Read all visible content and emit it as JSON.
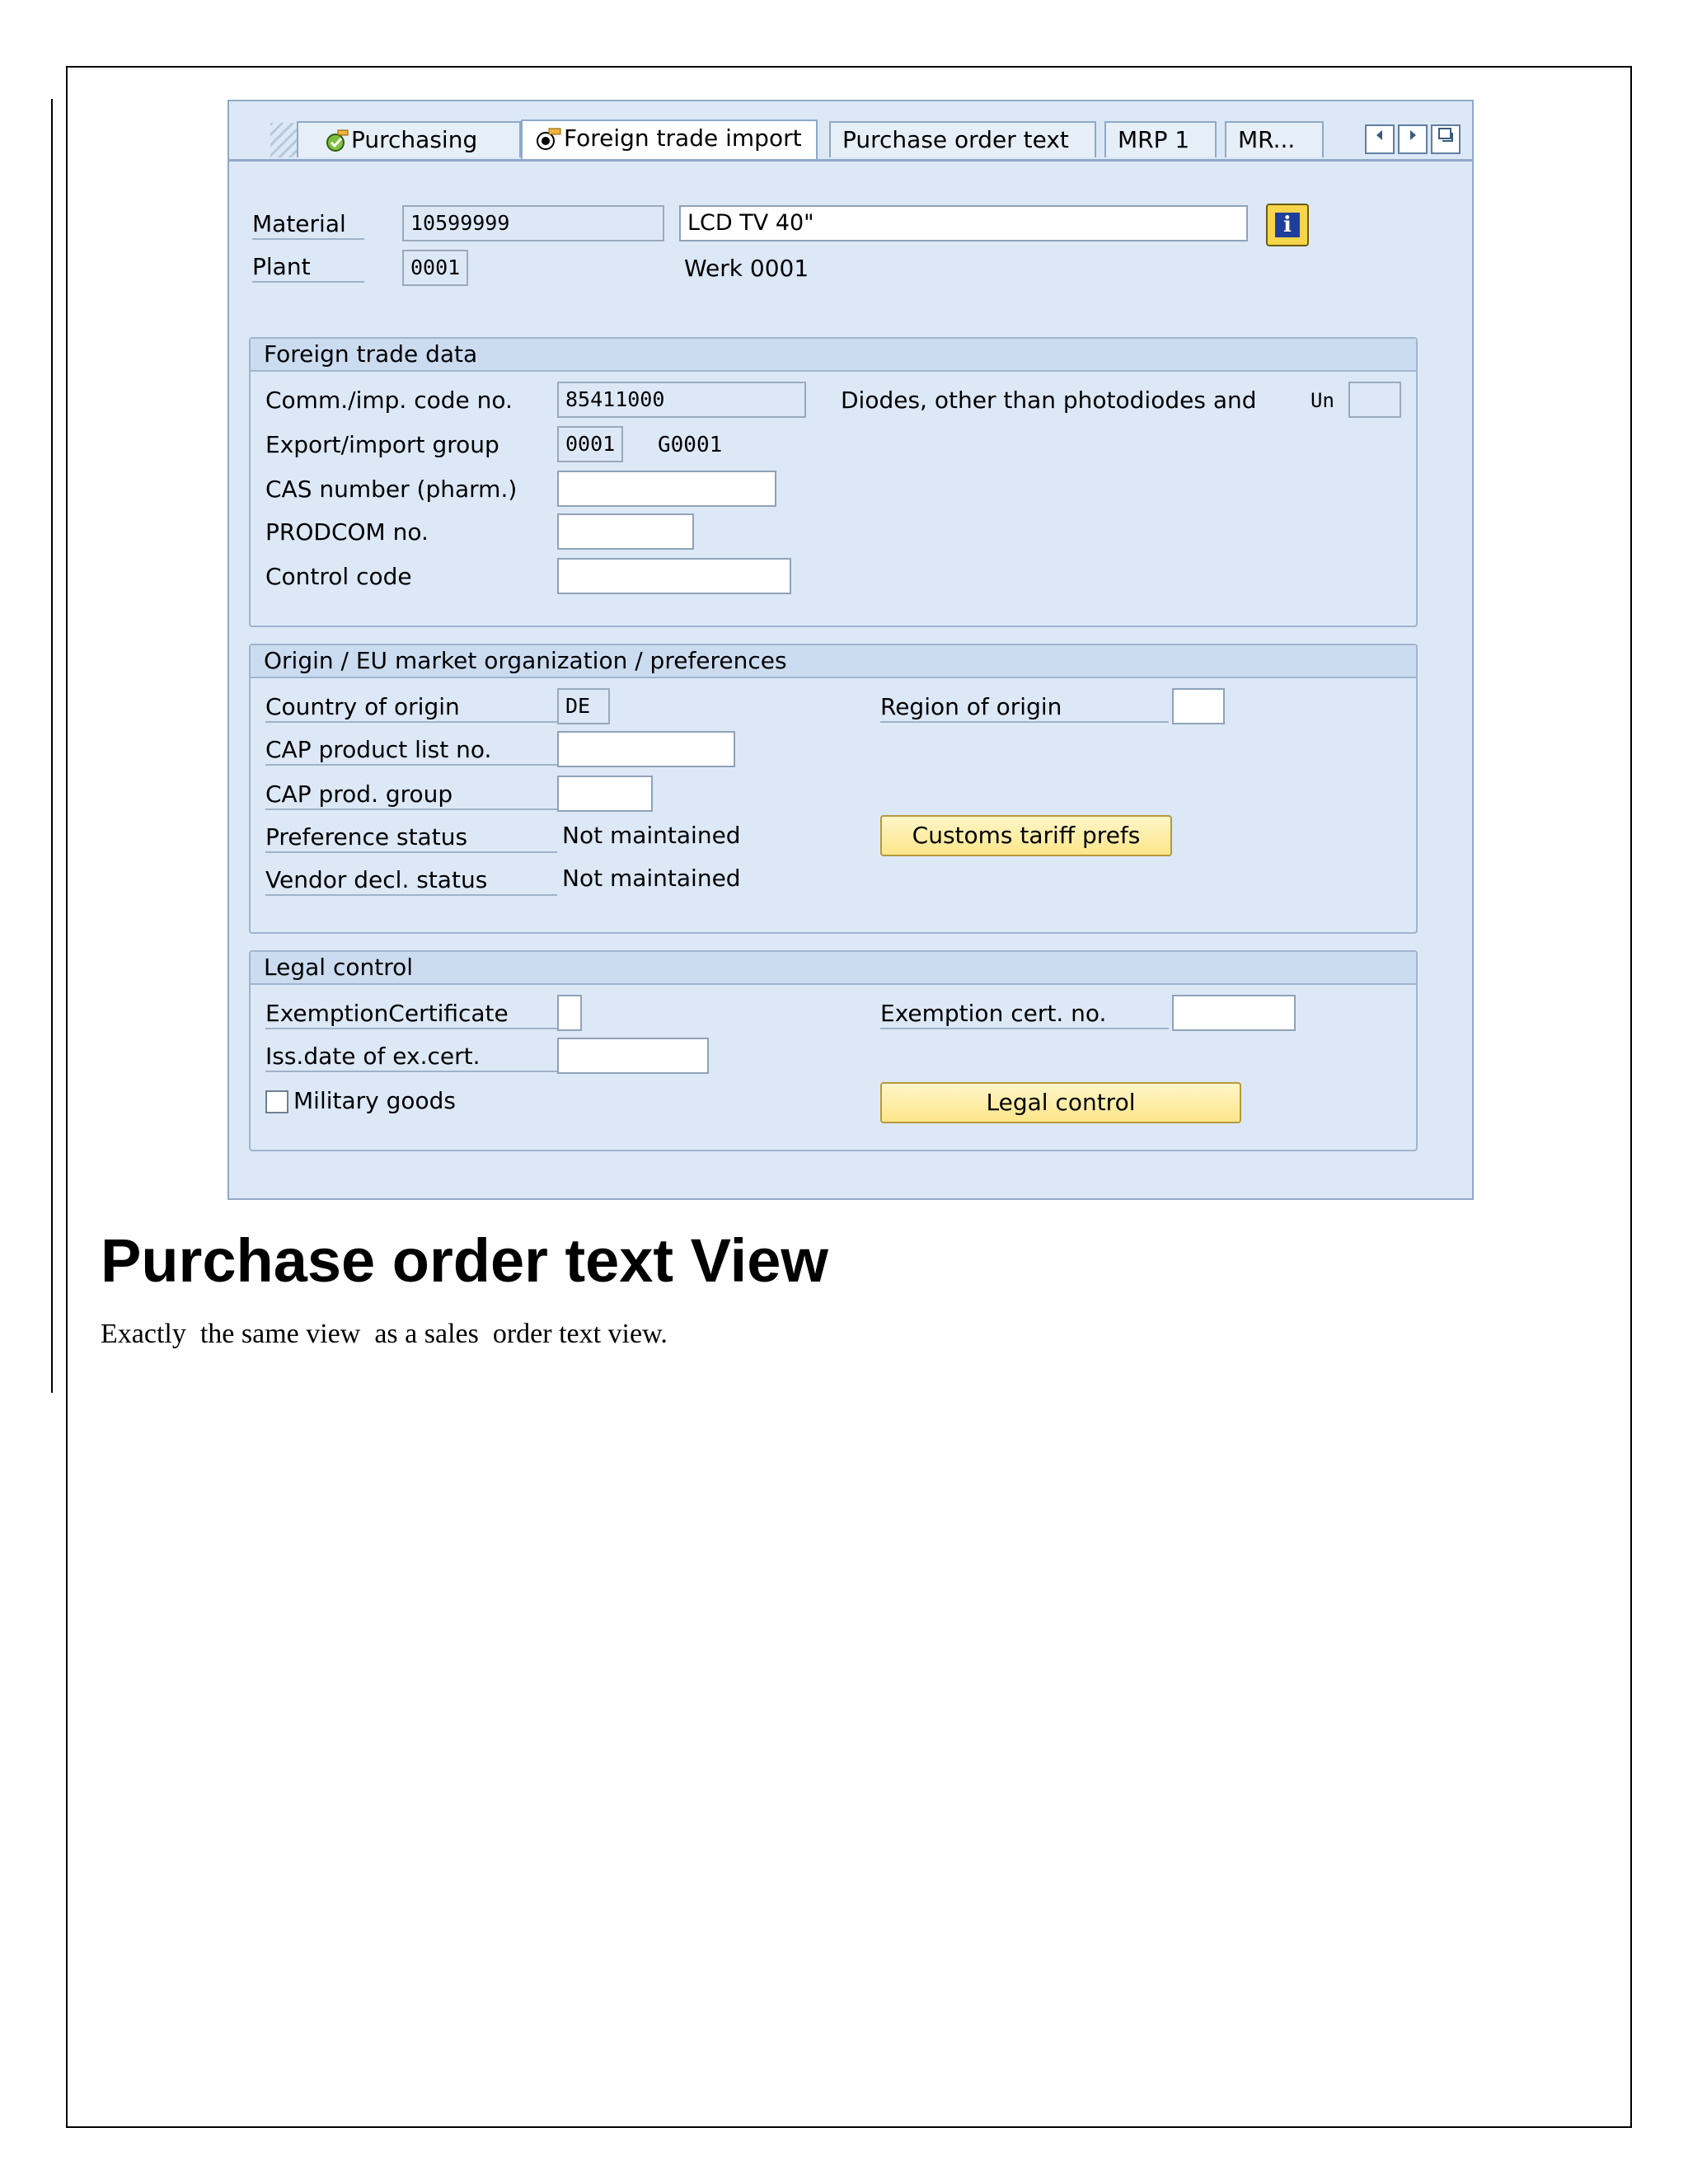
{
  "tabs": [
    {
      "label": "Purchasing",
      "icon": "purchasing-icon",
      "active": false
    },
    {
      "label": "Foreign trade import",
      "icon": "foreign-trade-icon",
      "active": true
    },
    {
      "label": "Purchase order text",
      "active": false
    },
    {
      "label": "MRP 1",
      "active": false
    },
    {
      "label": "MR...",
      "active": false
    }
  ],
  "header": {
    "material_label": "Material",
    "material_value": "10599999",
    "material_desc": "LCD TV 40\"",
    "plant_label": "Plant",
    "plant_value": "0001",
    "plant_desc": "Werk 0001"
  },
  "foreign_trade": {
    "title": "Foreign trade data",
    "comm_code_label": "Comm./imp. code no.",
    "comm_code_value": "85411000",
    "comm_code_desc": "Diodes, other than photodiodes and",
    "unit_label": "Un",
    "export_group_label": "Export/import group",
    "export_group_value": "0001",
    "export_group_desc": "G0001",
    "cas_label": "CAS number (pharm.)",
    "prodcom_label": "PRODCOM no.",
    "control_code_label": "Control code"
  },
  "origin": {
    "title": "Origin / EU market organization / preferences",
    "country_label": "Country of origin",
    "country_value": "DE",
    "region_label": "Region of origin",
    "cap_list_label": "CAP product list no.",
    "cap_group_label": "CAP prod. group",
    "pref_status_label": "Preference status",
    "pref_status_value": "Not maintained",
    "vendor_status_label": "Vendor decl. status",
    "vendor_status_value": "Not maintained",
    "customs_button": "Customs tariff prefs"
  },
  "legal": {
    "title": "Legal control",
    "exemption_label": "ExemptionCertificate",
    "exemption_no_label": "Exemption cert. no.",
    "issue_date_label": "Iss.date of ex.cert.",
    "military_label": "Military goods",
    "legal_button": "Legal control"
  },
  "doc": {
    "heading": "Purchase order text View",
    "body": "Exactly  the same view  as a sales  order text view."
  }
}
